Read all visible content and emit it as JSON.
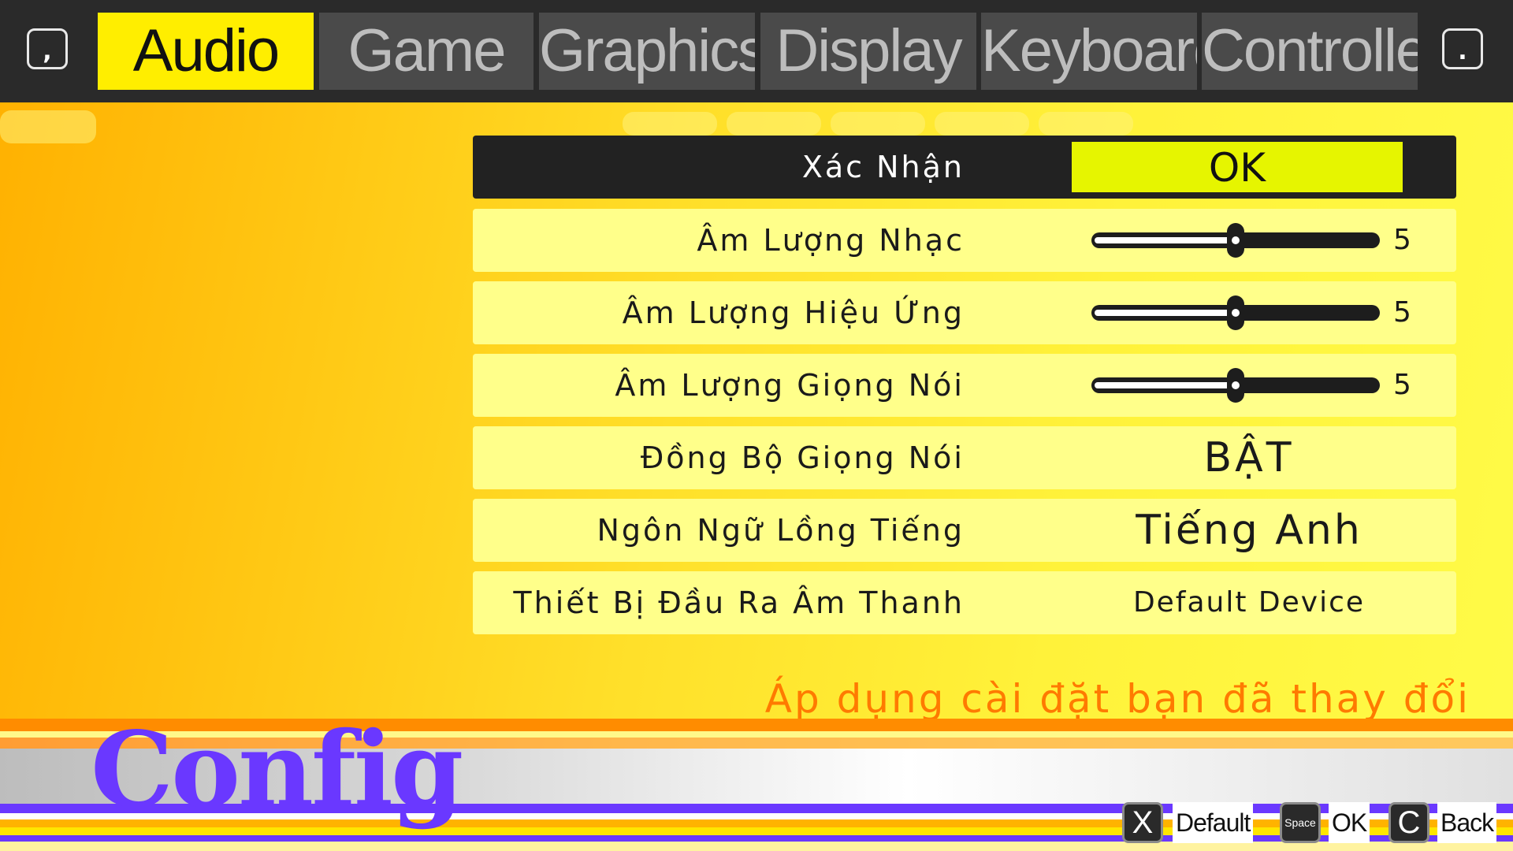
{
  "tabs": {
    "left_key": ",",
    "right_key": ".",
    "items": [
      "Audio",
      "Game",
      "Graphics",
      "Display",
      "Keyboard",
      "Controller"
    ],
    "active": "Audio"
  },
  "settings": {
    "confirm": {
      "label": "Xác Nhận",
      "value": "OK"
    },
    "music_volume": {
      "label": "Âm Lượng Nhạc",
      "value": 5,
      "max": 10
    },
    "sfx_volume": {
      "label": "Âm Lượng Hiệu Ứng",
      "value": 5,
      "max": 10
    },
    "voice_volume": {
      "label": "Âm Lượng Giọng Nói",
      "value": 5,
      "max": 10
    },
    "voice_sync": {
      "label": "Đồng Bộ Giọng Nói",
      "value": "BẬT"
    },
    "dub_language": {
      "label": "Ngôn Ngữ Lồng Tiếng",
      "value": "Tiếng Anh"
    },
    "audio_output": {
      "label": "Thiết Bị Đầu Ra Âm Thanh",
      "value": "Default Device"
    }
  },
  "hint": "Áp dụng cài đặt bạn đã thay đổi",
  "screen_title": "Config",
  "footer": {
    "default_key": "X",
    "default_label": "Default",
    "ok_key": "Space",
    "ok_label": "OK",
    "back_key": "C",
    "back_label": "Back"
  },
  "colors": {
    "active_tab": "#ffee00",
    "ok_highlight": "#e6f500",
    "hint_text": "#ff7a00",
    "title_purple": "#6a38ff"
  }
}
